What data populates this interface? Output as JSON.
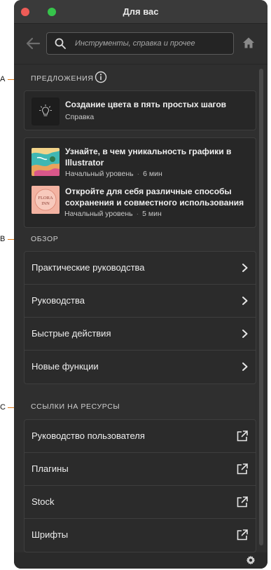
{
  "callouts": [
    "A",
    "B",
    "C"
  ],
  "window": {
    "title": "Для вас"
  },
  "search": {
    "placeholder": "Инструменты, справка и прочее"
  },
  "icons": {
    "back": "arrow-left-icon",
    "search": "search-icon",
    "home": "home-icon",
    "info": "info-icon",
    "lightbulb": "lightbulb-icon",
    "chevron": "chevron-right-icon",
    "external": "external-link-icon",
    "gear": "gear-icon"
  },
  "colors": {
    "accent_callout": "#e07a17",
    "close": "#ee5c57",
    "maximize": "#36c44b"
  },
  "suggestions": {
    "heading": "ПРЕДЛОЖЕНИЯ",
    "tip": {
      "title": "Создание цвета в пять простых шагов",
      "subtitle": "Справка"
    },
    "tutorials": [
      {
        "title": "Узнайте, в чем уникальность графики в Illustrator",
        "level": "Начальный уровень",
        "duration": "6 мин"
      },
      {
        "title": "Откройте для себя различные способы сохранения и совместного использования",
        "level": "Начальный уровень",
        "duration": "5 мин",
        "thumb_text": "FLORA INN"
      }
    ]
  },
  "browse": {
    "heading": "ОБЗОР",
    "items": [
      "Практические руководства",
      "Руководства",
      "Быстрые действия",
      "Новые функции"
    ]
  },
  "resources": {
    "heading": "ССЫЛКИ НА РЕСУРСЫ",
    "items": [
      "Руководство пользователя",
      "Плагины",
      "Stock",
      "Шрифты"
    ]
  }
}
